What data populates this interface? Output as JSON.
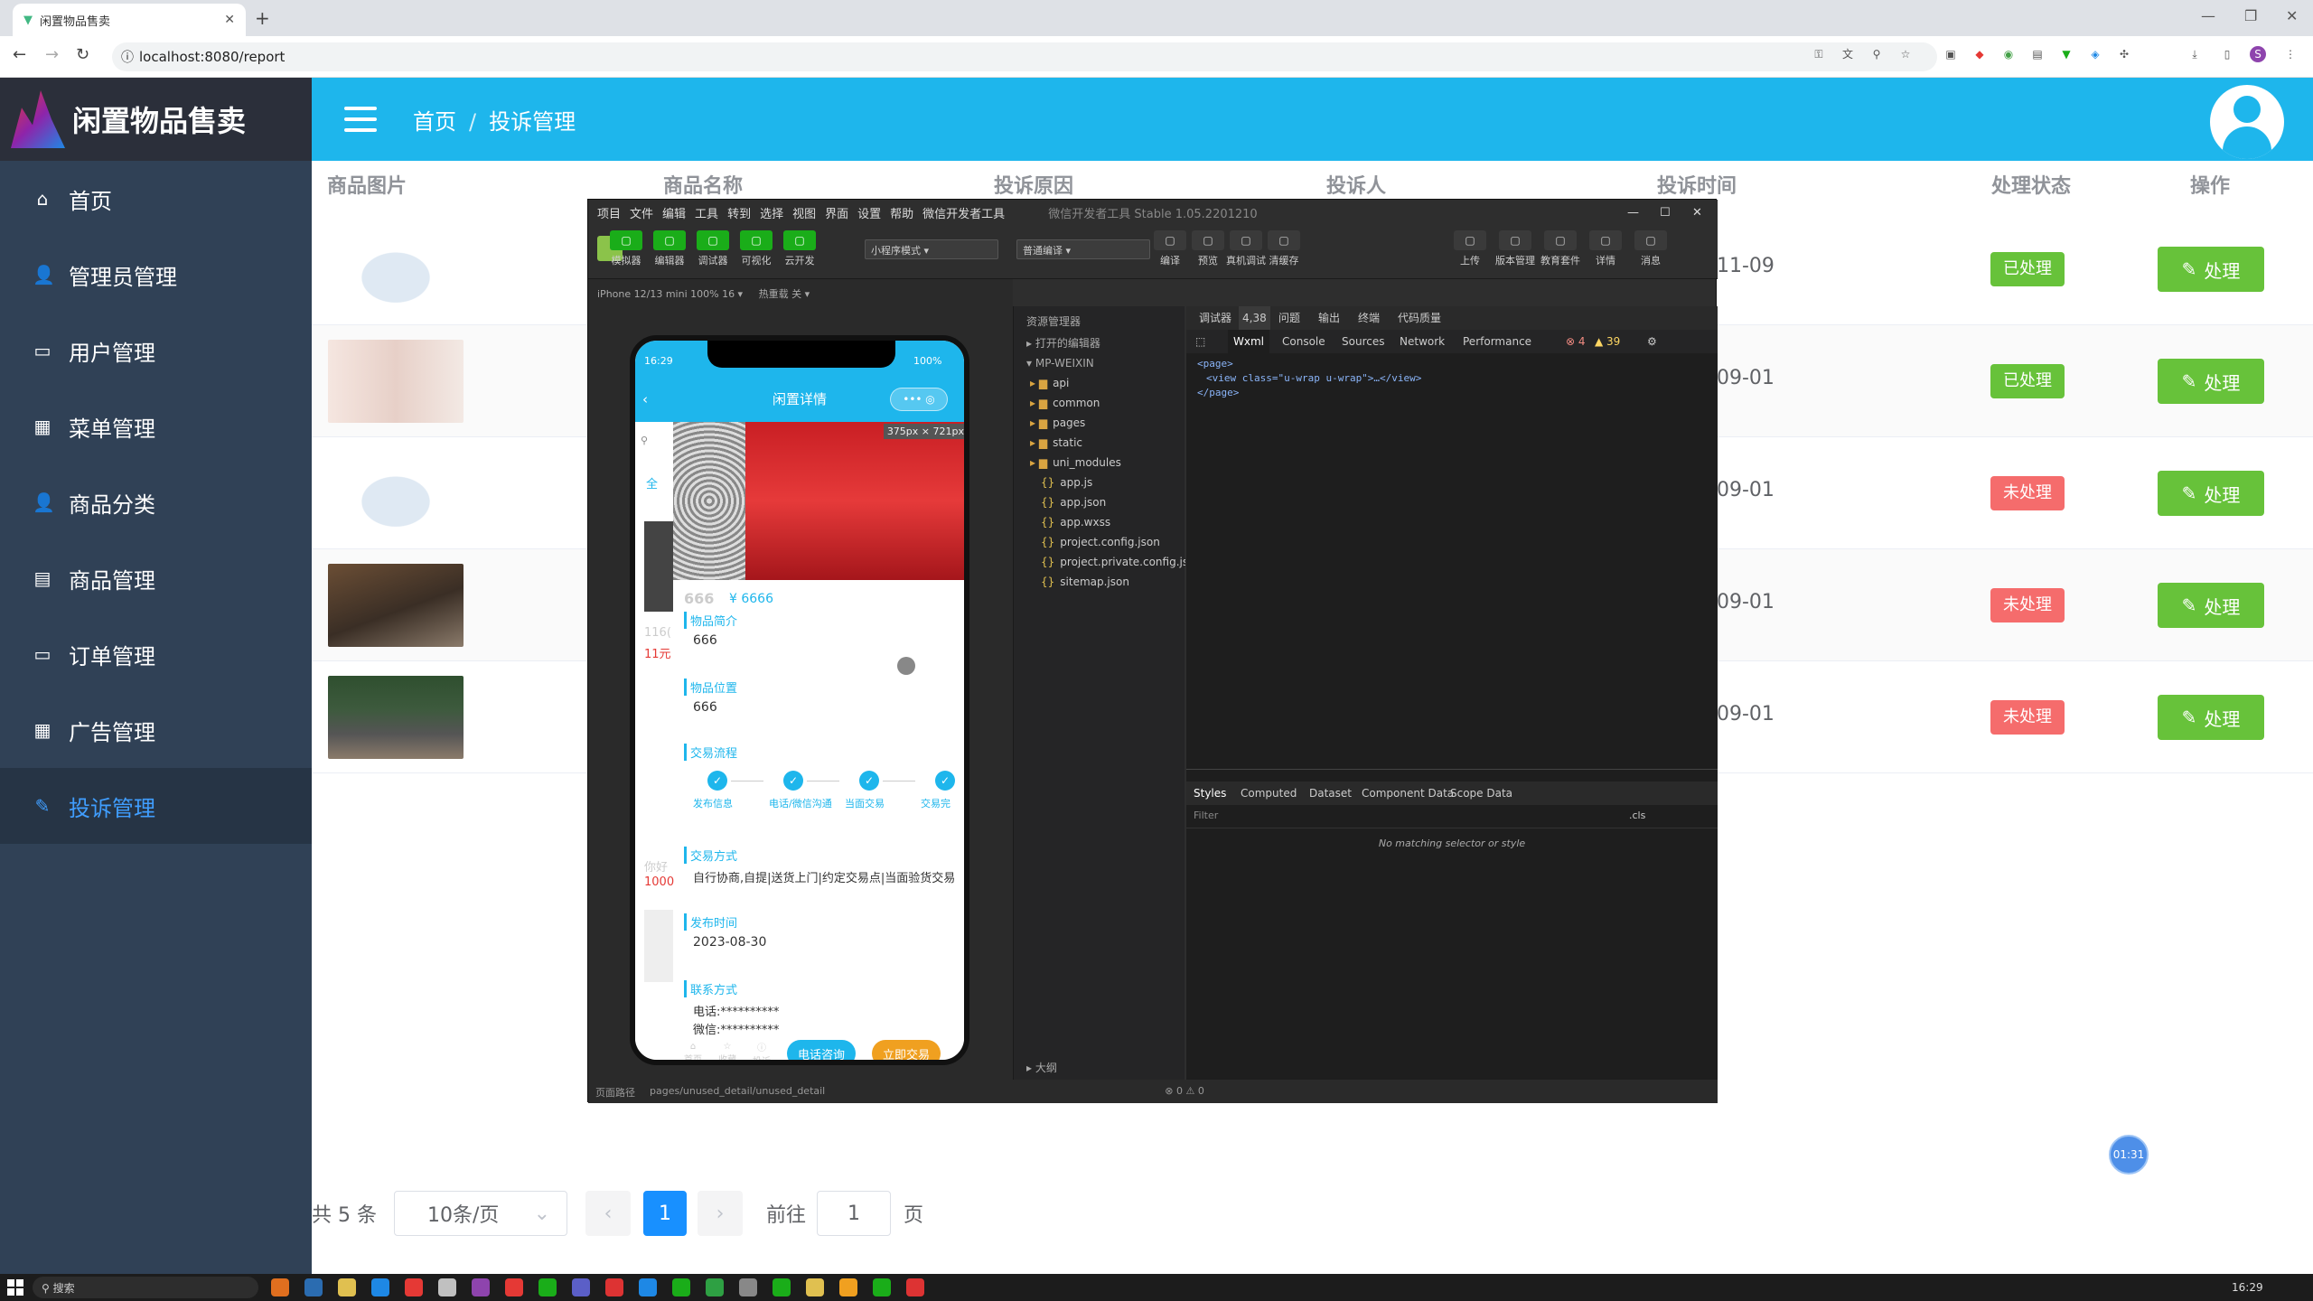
{
  "browser": {
    "tab_title": "闲置物品售卖",
    "url": "localhost:8080/report"
  },
  "app": {
    "logo_text": "闲置物品售卖",
    "breadcrumb": [
      "首页",
      "投诉管理"
    ],
    "menu": [
      {
        "label": "首页",
        "icon": "home-icon"
      },
      {
        "label": "管理员管理",
        "icon": "user-icon"
      },
      {
        "label": "用户管理",
        "icon": "folder-icon"
      },
      {
        "label": "菜单管理",
        "icon": "grid-icon"
      },
      {
        "label": "商品分类",
        "icon": "user-icon"
      },
      {
        "label": "商品管理",
        "icon": "document-icon"
      },
      {
        "label": "订单管理",
        "icon": "monitor-icon"
      },
      {
        "label": "广告管理",
        "icon": "calendar-icon"
      },
      {
        "label": "投诉管理",
        "icon": "edit-icon",
        "active": true
      }
    ]
  },
  "table": {
    "headers": [
      "商品图片",
      "商品名称",
      "投诉原因",
      "投诉人",
      "投诉时间",
      "处理状态",
      "操作"
    ],
    "rows": [
      {
        "image": "sneaker-photo",
        "time": "11-09",
        "status": "已处理",
        "status_type": "ok",
        "action": "处理"
      },
      {
        "image": "girl-photo",
        "time": "09-01",
        "status": "已处理",
        "status_type": "ok",
        "action": "处理"
      },
      {
        "image": "sneaker-photo",
        "time": "09-01",
        "status": "未处理",
        "status_type": "no",
        "action": "处理"
      },
      {
        "image": "phone-photo",
        "time": "09-01",
        "status": "未处理",
        "status_type": "no",
        "action": "处理"
      },
      {
        "image": "laptop-photo",
        "time": "09-01",
        "status": "未处理",
        "status_type": "no",
        "action": "处理"
      }
    ]
  },
  "pagination": {
    "total": "共 5 条",
    "page_size": "10条/页",
    "current": "1",
    "goto_label": "前往",
    "goto_value": "1",
    "page_unit": "页"
  },
  "timer": "01:31",
  "devtools": {
    "title": "微信开发者工具 Stable 1.05.2201210",
    "menu": [
      "项目",
      "文件",
      "编辑",
      "工具",
      "转到",
      "选择",
      "视图",
      "界面",
      "设置",
      "帮助",
      "微信开发者工具"
    ],
    "toolbar_left": [
      "模拟器",
      "编辑器",
      "调试器",
      "可视化",
      "云开发"
    ],
    "mode_select": "小程序模式",
    "compile_select": "普通编译",
    "toolbar_mid": [
      "编译",
      "预览",
      "真机调试",
      "清缓存"
    ],
    "toolbar_right": [
      "上传",
      "版本管理",
      "教育套件",
      "详情",
      "消息"
    ],
    "device": "iPhone 12/13 mini 100% 16 ▾",
    "hotreload": "热重载 关 ▾",
    "explorer_title": "资源管理器",
    "explorer_sections": [
      "打开的编辑器",
      "MP-WEIXIN"
    ],
    "files": [
      "api",
      "common",
      "pages",
      "static",
      "uni_modules",
      "app.js",
      "app.json",
      "app.wxss",
      "project.config.json",
      "project.private.config.js...",
      "sitemap.json"
    ],
    "outline": "大纲",
    "debug_tabs": [
      "调试器",
      "4,38",
      "问题",
      "输出",
      "终端",
      "代码质量"
    ],
    "panel_tabs": [
      "Wxml",
      "Console",
      "Sources",
      "Network",
      "Performance"
    ],
    "errors": "4",
    "warnings": "39",
    "wxml_lines": [
      "<page>",
      "<view class=\"u-wrap u-wrap\">…</view>",
      "</page>"
    ],
    "style_tabs": [
      "Styles",
      "Computed",
      "Dataset",
      "Component Data",
      "Scope Data"
    ],
    "filter_placeholder": "Filter",
    "cls": ".cls",
    "no_match": "No matching selector or style",
    "footer_path_label": "页面路径",
    "footer_path": "pages/unused_detail/unused_detail",
    "footer_status": "⊗ 0 ⚠ 0"
  },
  "phone": {
    "time": "16:29",
    "battery": "100%",
    "nav_title": "闲置详情",
    "image_tag": "375px × 721px",
    "name": "666",
    "price": "¥ 6666",
    "section_intro": "物品简介",
    "intro": "666",
    "section_location": "物品位置",
    "location": "666",
    "section_flow": "交易流程",
    "steps": [
      "发布信息",
      "电话/微信沟通",
      "当面交易",
      "交易完"
    ],
    "section_method": "交易方式",
    "method": "自行协商,自提|送货上门|约定交易点|当面验货交易",
    "section_time": "发布时间",
    "publish_time": "2023-08-30",
    "section_contact": "联系方式",
    "phone_line": "电话:**********",
    "wechat_line": "微信:**********",
    "bottom_nav": [
      "首页",
      "收藏",
      "投诉"
    ],
    "btn_call": "电话咨询",
    "btn_trade": "立即交易",
    "left_peek": [
      "116(",
      "11元",
      "你好",
      "1000"
    ]
  },
  "taskbar": {
    "search": "搜索",
    "time": "16:29"
  }
}
